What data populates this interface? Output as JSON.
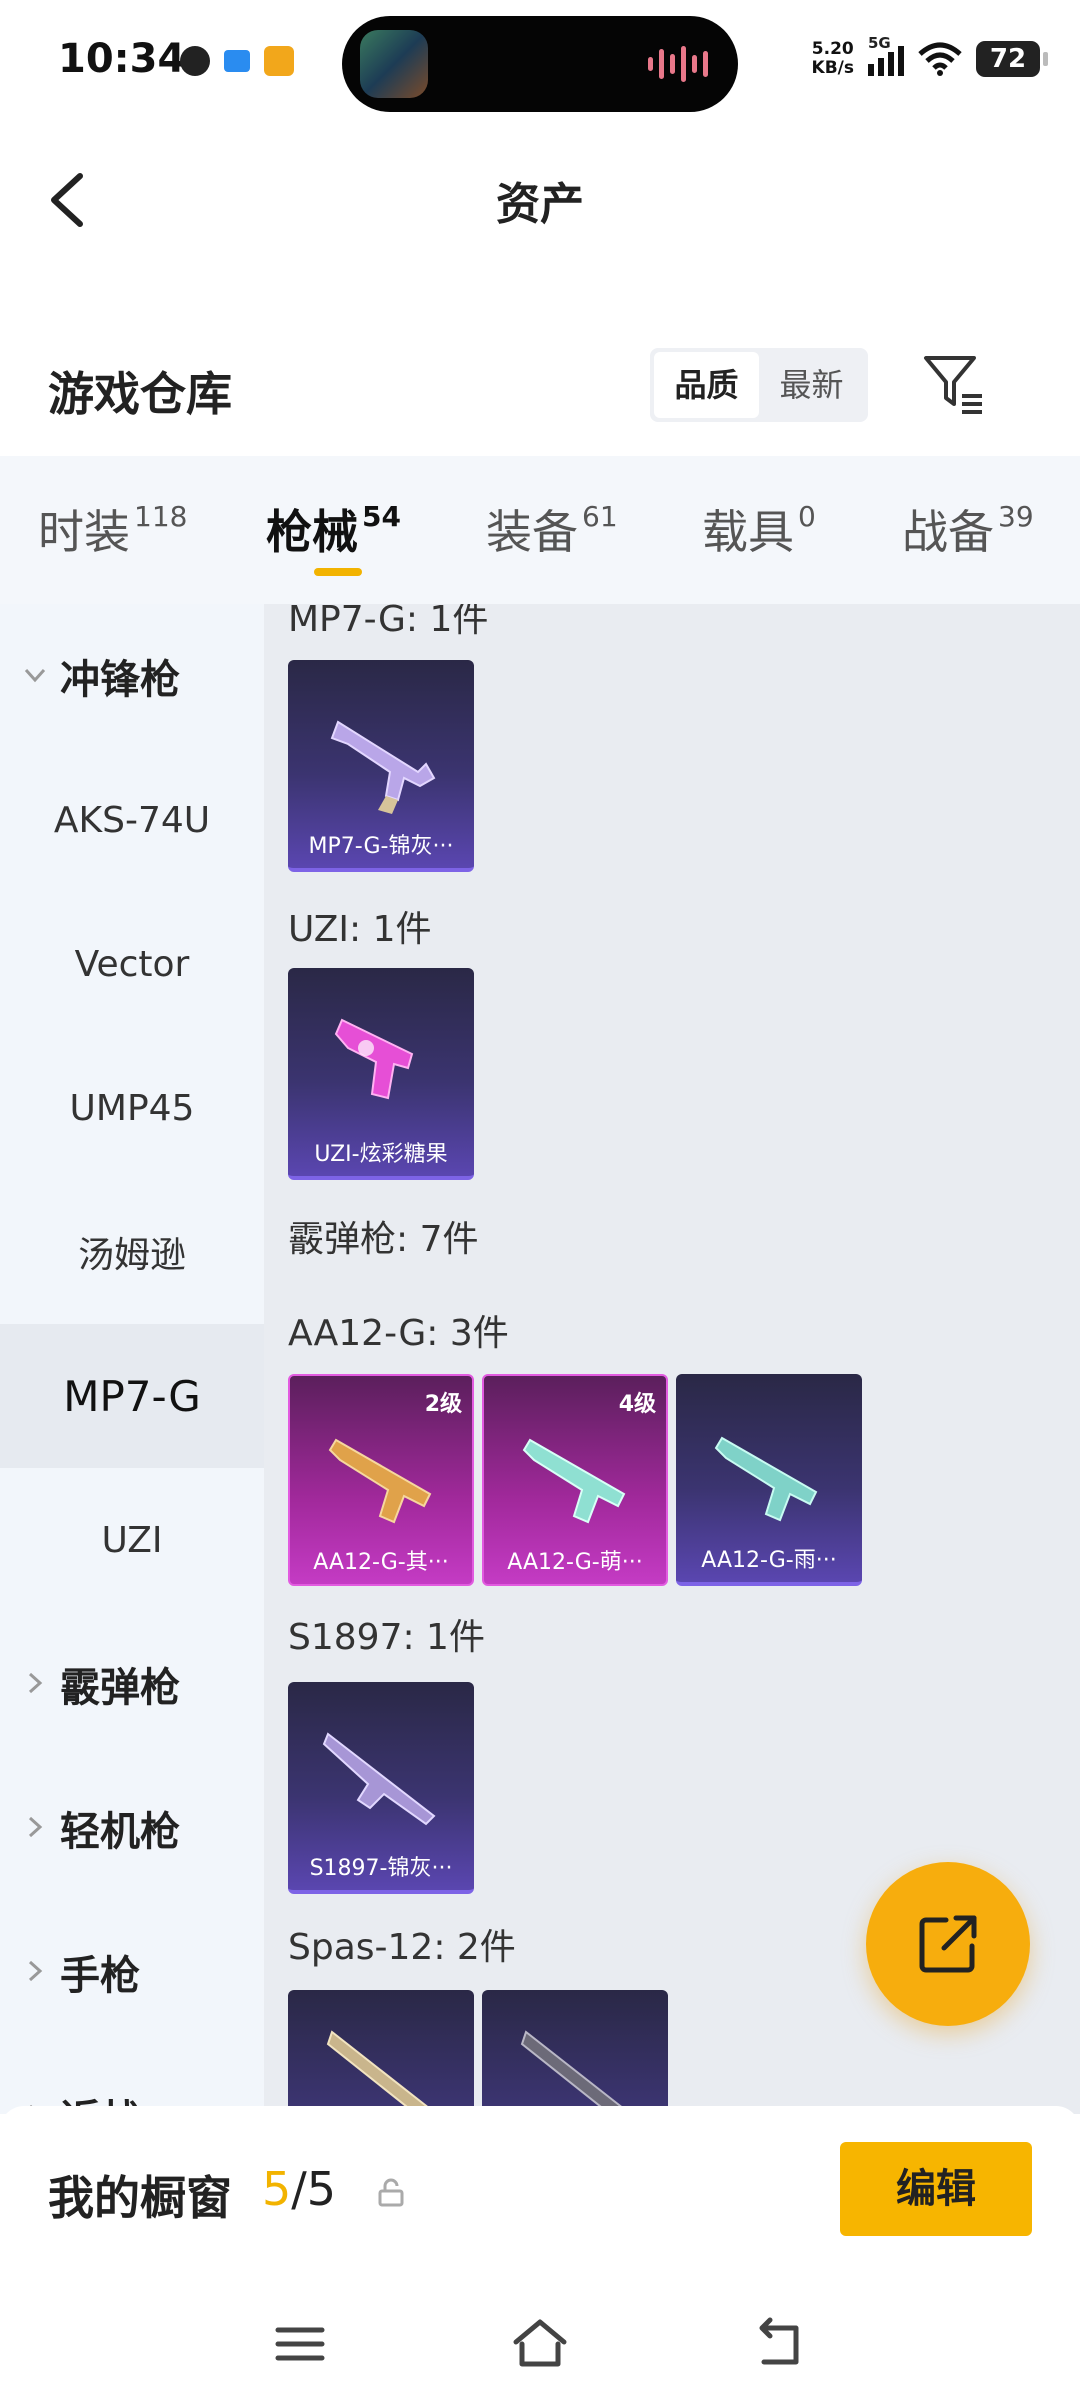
{
  "status_bar": {
    "time": "10:34",
    "net_speed": "5.20",
    "net_unit": "KB/s",
    "network": "5G",
    "battery": "72"
  },
  "header": {
    "title": "资产"
  },
  "warehouse": {
    "title": "游戏仓库",
    "sort_options": [
      "品质",
      "最新"
    ],
    "active_sort": "品质"
  },
  "tabs": [
    {
      "label": "时装",
      "count": "118"
    },
    {
      "label": "枪械",
      "count": "54"
    },
    {
      "label": "装备",
      "count": "61"
    },
    {
      "label": "载具",
      "count": "0"
    },
    {
      "label": "战备",
      "count": "39"
    }
  ],
  "active_tab": "枪械",
  "sidebar": {
    "items": [
      {
        "label": "冲锋枪",
        "type": "group-expanded"
      },
      {
        "label": "AKS-74U",
        "type": "item"
      },
      {
        "label": "Vector",
        "type": "item"
      },
      {
        "label": "UMP45",
        "type": "item"
      },
      {
        "label": "汤姆逊",
        "type": "item"
      },
      {
        "label": "MP7-G",
        "type": "item-selected"
      },
      {
        "label": "UZI",
        "type": "item"
      },
      {
        "label": "霰弹枪",
        "type": "group-collapsed"
      },
      {
        "label": "轻机枪",
        "type": "group-collapsed"
      },
      {
        "label": "手枪",
        "type": "group-collapsed"
      },
      {
        "label": "近战",
        "type": "group-collapsed"
      }
    ]
  },
  "content": {
    "sections": [
      {
        "label": "MP7-G: 1件",
        "cards": [
          {
            "name": "MP7-G-锦灰···",
            "tier": "purple",
            "level": ""
          }
        ]
      },
      {
        "label": "UZI: 1件",
        "cards": [
          {
            "name": "UZI-炫彩糖果",
            "tier": "purple",
            "level": ""
          }
        ]
      },
      {
        "label": "霰弹枪: 7件",
        "cards": []
      },
      {
        "label": "AA12-G: 3件",
        "cards": [
          {
            "name": "AA12-G-其···",
            "tier": "pink",
            "level": "2级"
          },
          {
            "name": "AA12-G-萌···",
            "tier": "pink",
            "level": "4级"
          },
          {
            "name": "AA12-G-雨···",
            "tier": "purple",
            "level": ""
          }
        ]
      },
      {
        "label": "S1897: 1件",
        "cards": [
          {
            "name": "S1897-锦灰···",
            "tier": "purple",
            "level": ""
          }
        ]
      },
      {
        "label": "Spas-12: 2件",
        "cards": [
          {
            "name": "",
            "tier": "purple",
            "level": ""
          },
          {
            "name": "",
            "tier": "purple",
            "level": ""
          }
        ]
      }
    ]
  },
  "showcase": {
    "label": "我的橱窗",
    "current": "5",
    "separator": "/",
    "max": "5",
    "edit_label": "编辑"
  },
  "colors": {
    "accent": "#f7b500",
    "purple_tier": "#5a46b0",
    "pink_tier": "#c43bc4"
  }
}
